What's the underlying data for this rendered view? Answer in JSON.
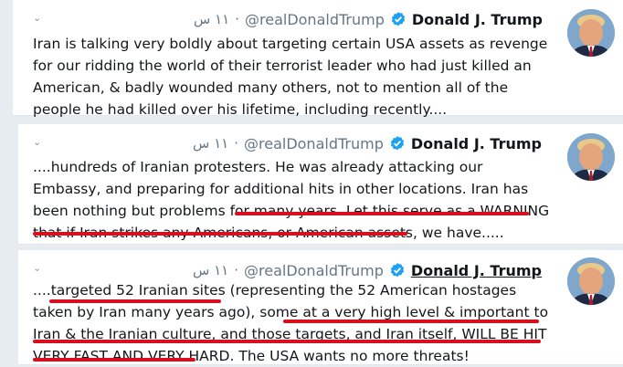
{
  "tweets": [
    {
      "name": "Donald J. Trump",
      "handle": "@realDonaldTrump",
      "time": "١١ س",
      "dot": "·",
      "text": "Iran is talking very boldly about targeting certain USA assets as revenge for our ridding the world of their terrorist leader who had just killed an American, & badly wounded many others, not to mention all of the people he had killed over his lifetime, including recently...."
    },
    {
      "name": "Donald J. Trump",
      "handle": "@realDonaldTrump",
      "time": "١١ س",
      "dot": "·",
      "text": "....hundreds of Iranian protesters. He was already attacking our Embassy, and preparing for additional hits in other locations. Iran has been nothing but problems for many years. Let this serve as a WARNING that if Iran strikes any Americans, or American assets, we have....."
    },
    {
      "name": "Donald J. Trump",
      "handle": "@realDonaldTrump",
      "time": "١١ س",
      "dot": "·",
      "text": "....targeted 52 Iranian sites (representing the 52 American hostages taken by Iran many years ago), some at a very high level & important to Iran & the Iranian culture, and those targets, and Iran itself, WILL BE HIT VERY FAST AND VERY HARD. The USA wants no more threats!"
    }
  ],
  "colors": {
    "page_bg": "#e6ecf0",
    "verified": "#1da1f2",
    "underline": "#d6101e",
    "muted": "#657786"
  },
  "icons": {
    "verified": "verified-badge-icon",
    "menu": "chevron-down-icon"
  }
}
